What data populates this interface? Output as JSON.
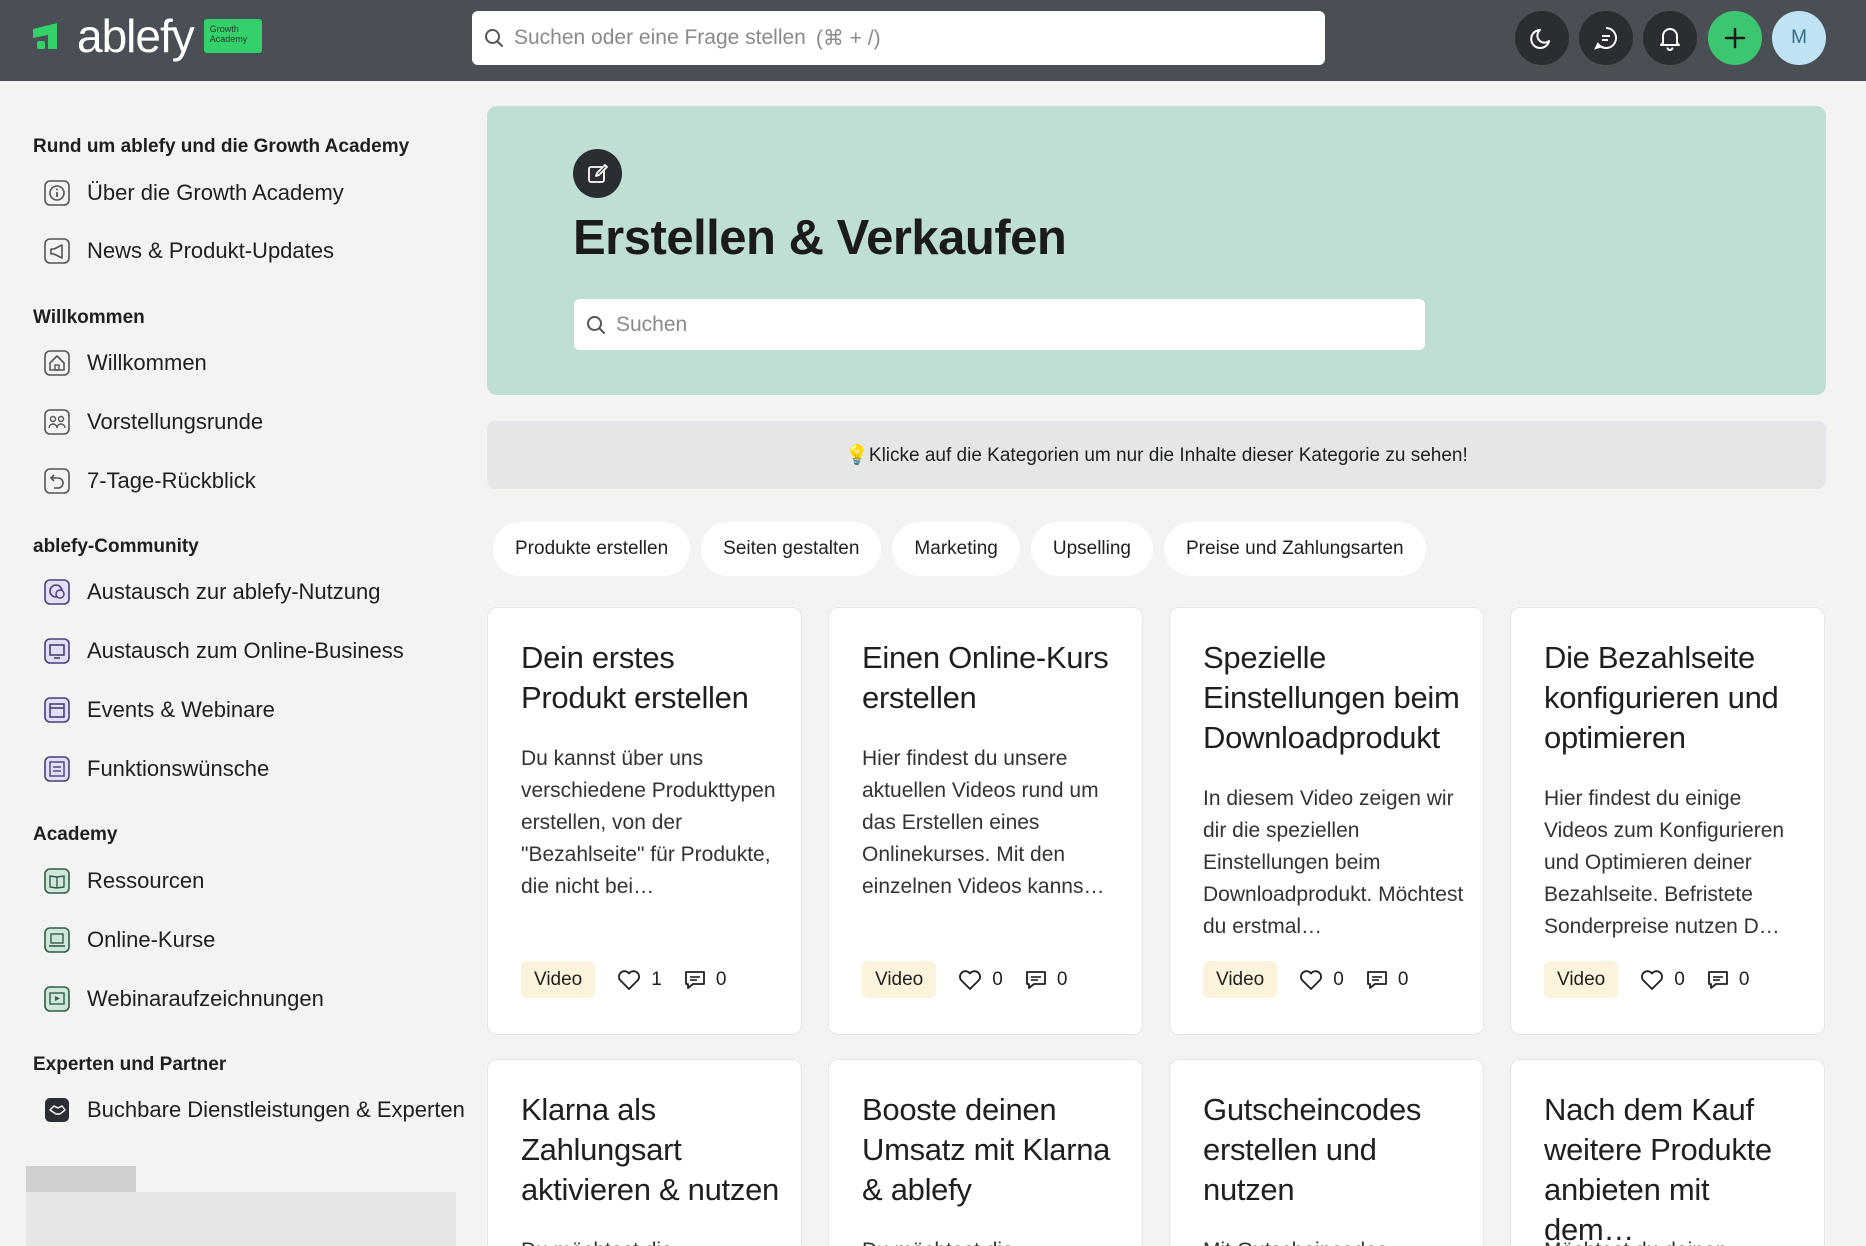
{
  "brand": {
    "name": "ablefy",
    "badge_line1": "Growth",
    "badge_line2": "Academy",
    "accent": "#34d06c"
  },
  "topbar": {
    "search_placeholder": "Suchen oder eine Frage stellen",
    "search_shortcut": "(⌘ + /)",
    "avatar_initial": "M",
    "icons": [
      "moon-icon",
      "chat-icon",
      "bell-icon",
      "plus-icon"
    ]
  },
  "sidebar": {
    "sections": [
      {
        "title": "Rund um ablefy und die Growth Academy",
        "items": [
          {
            "label": "Über die Growth Academy",
            "icon": "info-icon"
          },
          {
            "label": "News & Produkt-Updates",
            "icon": "megaphone-icon"
          }
        ]
      },
      {
        "title": "Willkommen",
        "items": [
          {
            "label": "Willkommen",
            "icon": "home-icon"
          },
          {
            "label": "Vorstellungsrunde",
            "icon": "people-icon"
          },
          {
            "label": "7-Tage-Rückblick",
            "icon": "undo-icon"
          }
        ]
      },
      {
        "title": "ablefy-Community",
        "items": [
          {
            "label": "Austausch zur ablefy-Nutzung",
            "icon": "chat-bubbles-icon"
          },
          {
            "label": "Austausch zum Online-Business",
            "icon": "monitor-icon"
          },
          {
            "label": "Events & Webinare",
            "icon": "calendar-icon"
          },
          {
            "label": "Funktionswünsche",
            "icon": "list-icon"
          }
        ]
      },
      {
        "title": "Academy",
        "items": [
          {
            "label": "Ressourcen",
            "icon": "book-icon"
          },
          {
            "label": "Online-Kurse",
            "icon": "laptop-icon"
          },
          {
            "label": "Webinaraufzeichnungen",
            "icon": "play-icon"
          }
        ]
      },
      {
        "title": "Experten und Partner",
        "items": [
          {
            "label": "Buchbare Dienstleistungen & Experten",
            "icon": "handshake-icon"
          }
        ]
      }
    ]
  },
  "hero": {
    "title": "Erstellen & Verkaufen",
    "search_placeholder": "Suchen",
    "icon": "edit-icon"
  },
  "hint": {
    "text": "💡Klicke auf die Kategorien um nur die Inhalte dieser Kategorie zu sehen!"
  },
  "categories": [
    "Produkte erstellen",
    "Seiten gestalten",
    "Marketing",
    "Upselling",
    "Preise und Zahlungsarten"
  ],
  "cards": [
    {
      "title": "Dein erstes Produkt erstellen",
      "desc": "Du kannst über uns verschiedene Produkttypen erstellen, von der \"Bezahlseite\" für Produkte, die nicht bei…",
      "badge": "Video",
      "likes": "1",
      "comments": "0"
    },
    {
      "title": "Einen Online-Kurs erstellen",
      "desc": "Hier findest du unsere aktuellen Videos rund um das Erstellen eines Onlinekurses. Mit den einzelnen Videos kanns…",
      "badge": "Video",
      "likes": "0",
      "comments": "0"
    },
    {
      "title": "Spezielle Einstellungen beim Downloadprodukt",
      "desc": "In diesem Video zeigen wir dir die speziellen Einstellungen beim Downloadprodukt. Möchtest du erstmal…",
      "badge": "Video",
      "likes": "0",
      "comments": "0"
    },
    {
      "title": "Die Bezahlseite konfigurieren und optimieren",
      "desc": "Hier findest du einige Videos zum Konfigurieren und Optimieren deiner Bezahlseite. Befristete Sonderpreise nutzen D…",
      "badge": "Video",
      "likes": "0",
      "comments": "0"
    },
    {
      "title": "Klarna als Zahlungsart aktivieren & nutzen",
      "desc": "Du möchtest die…"
    },
    {
      "title": "Booste deinen Umsatz mit Klarna & ablefy",
      "desc": "Du möchtest die…"
    },
    {
      "title": "Gutscheincodes erstellen und nutzen",
      "desc": "Mit Gutscheincodes…"
    },
    {
      "title": "Nach dem Kauf weitere Produkte anbieten mit dem…",
      "desc": "Möchtest du deinen…"
    }
  ]
}
